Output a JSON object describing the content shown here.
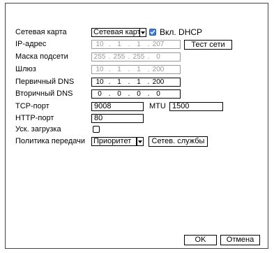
{
  "labels": {
    "network_card": "Сетевая карта",
    "ip_address": "IP-адрес",
    "subnet_mask": "Маска подсети",
    "gateway": "Шлюз",
    "primary_dns": "Первичный DNS",
    "secondary_dns": "Вторичный DNS",
    "tcp_port": "TCP-порт",
    "mtu": "MTU",
    "http_port": "HTTP-порт",
    "fast_download": "Уск. загрузка",
    "transfer_policy": "Политика передачи",
    "dhcp": "Вкл. DHCP"
  },
  "fields": {
    "network_card": "Сетевая карт",
    "ip_address": [
      "10",
      "1",
      "1",
      "207"
    ],
    "subnet_mask": [
      "255",
      "255",
      "255",
      "0"
    ],
    "gateway": [
      "10",
      "1",
      "1",
      "200"
    ],
    "primary_dns": [
      "10",
      "1",
      "1",
      "200"
    ],
    "secondary_dns": [
      "0",
      "0",
      "0",
      "0"
    ],
    "tcp_port": "9008",
    "mtu": "1500",
    "http_port": "80",
    "transfer_policy": "Приоритет"
  },
  "state": {
    "dhcp_enabled": true,
    "fast_download": false
  },
  "buttons": {
    "test_network": "Тест сети",
    "net_services": "Сетев. службы",
    "ok": "OK",
    "cancel": "Отмена"
  },
  "colors": {
    "checkbox_on": "#3b7bd6",
    "disabled_text": "#9a9a9a"
  },
  "icons": {
    "dropdown": "chevron-down-icon",
    "check": "checkmark-icon"
  }
}
